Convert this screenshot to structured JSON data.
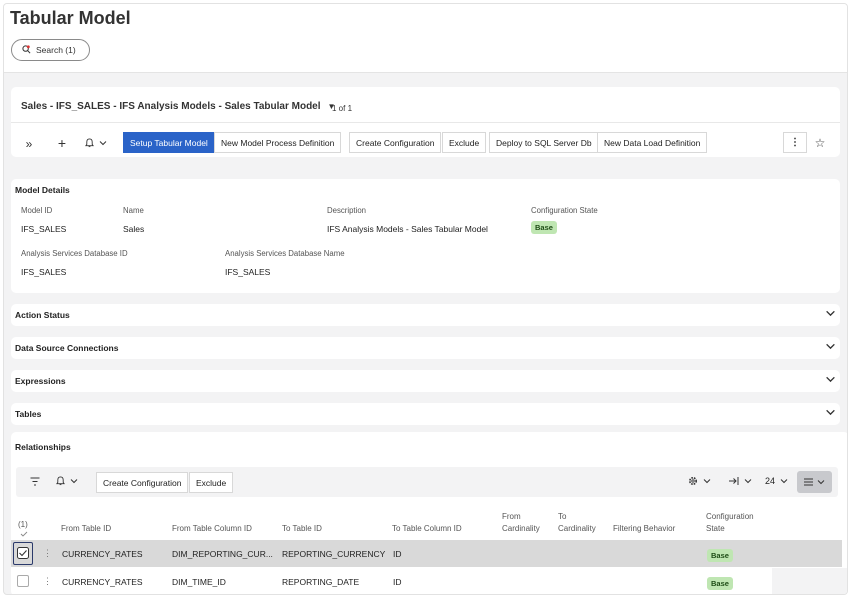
{
  "page": {
    "title": "Tabular Model",
    "search_label": "Search (1)"
  },
  "record": {
    "title": "Sales - IFS_SALES - IFS Analysis Models - Sales Tabular Model",
    "count": "1 of 1"
  },
  "toolbar": {
    "setup_tabular_model": "Setup Tabular Model",
    "new_model_process_definition": "New Model Process Definition",
    "create_configuration": "Create Configuration",
    "exclude": "Exclude",
    "deploy_to_sql_server_db": "Deploy to SQL Server Db",
    "new_data_load_definition": "New Data Load Definition"
  },
  "model_details": {
    "title": "Model Details",
    "model_id_label": "Model ID",
    "model_id": "IFS_SALES",
    "name_label": "Name",
    "name": "Sales",
    "description_label": "Description",
    "description": "IFS Analysis Models - Sales Tabular Model",
    "config_state_label": "Configuration State",
    "config_state": "Base",
    "as_db_id_label": "Analysis Services Database ID",
    "as_db_id": "IFS_SALES",
    "as_db_name_label": "Analysis Services Database Name",
    "as_db_name": "IFS_SALES"
  },
  "sections": {
    "action_status": "Action Status",
    "data_source_connections": "Data Source Connections",
    "expressions": "Expressions",
    "tables": "Tables",
    "relationships": "Relationships"
  },
  "relationships": {
    "create_configuration": "Create Configuration",
    "exclude": "Exclude",
    "page_size": "24",
    "selected_count": "(1)",
    "headers": {
      "from_table_id": "From Table ID",
      "from_table_column_id": "From Table Column ID",
      "to_table_id": "To Table ID",
      "to_table_column_id": "To Table Column ID",
      "from_cardinality_1": "From",
      "from_cardinality_2": "Cardinality",
      "to_cardinality_1": "To",
      "to_cardinality_2": "Cardinality",
      "filtering_behavior": "Filtering Behavior",
      "config_state_1": "Configuration",
      "config_state_2": "State"
    },
    "rows": [
      {
        "from_table": "CURRENCY_RATES",
        "from_column": "DIM_REPORTING_CUR...",
        "to_table": "REPORTING_CURRENCY",
        "to_column": "ID",
        "state": "Base",
        "selected": true
      },
      {
        "from_table": "CURRENCY_RATES",
        "from_column": "DIM_TIME_ID",
        "to_table": "REPORTING_DATE",
        "to_column": "ID",
        "state": "Base",
        "selected": false
      }
    ]
  },
  "colors": {
    "primary": "#2a63c8",
    "badge_bg": "#bfe6b2",
    "selected_row": "#d9d9d9"
  }
}
